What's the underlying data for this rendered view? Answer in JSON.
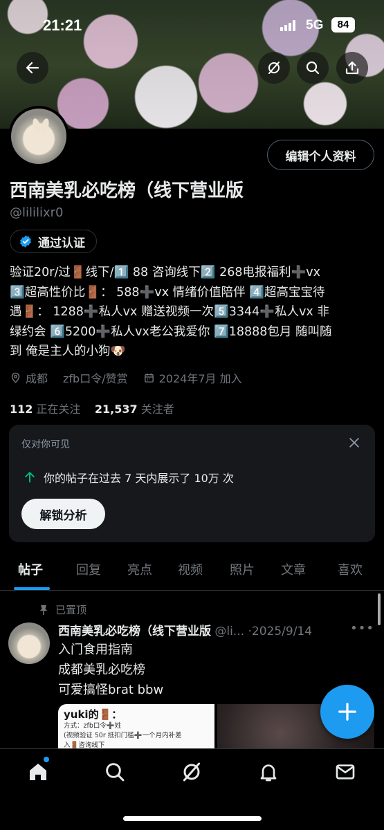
{
  "status_bar": {
    "time": "21:21",
    "network": "5G",
    "battery": "84"
  },
  "profile": {
    "name": "西南美乳必吃榜（线下营业版",
    "handle": "@lililixr0",
    "edit_label": "编辑个人资料",
    "verified_label": "通过认证",
    "bio": "验证20r/过🚪线下/1️⃣ 88 咨询线下2️⃣ 268电报福利➕vx\n3️⃣超高性价比🚪： 588➕vx 情绪价值陪伴 4️⃣超高宝宝待\n遇🚪： 1288➕私人vx 赠送视频一次5️⃣3344➕私人vx 非\n绿约会 6️⃣5200➕私人vx老公我爱你 7️⃣18888包月 随叫随\n到 俺是主人的小狗🐶",
    "location": "成都",
    "website": "zfb口令/赞赏",
    "joined": "2024年7月 加入",
    "following_count": "112",
    "following_label": "正在关注",
    "followers_count": "21,537",
    "followers_label": "关注者"
  },
  "insight_card": {
    "visibility": "仅对你可见",
    "stat_text": "你的帖子在过去 7 天内展示了 10万 次",
    "button_label": "解锁分析"
  },
  "tabs": [
    "帖子",
    "回复",
    "亮点",
    "视频",
    "照片",
    "文章",
    "喜欢"
  ],
  "post": {
    "pinned_label": "已置顶",
    "name": "西南美乳必吃榜（线下营业版",
    "handle": "@li...",
    "date": "·2025/9/14",
    "lines": [
      "入门食用指南",
      "成都美乳必吃榜",
      "可爱搞怪brat  bbw"
    ],
    "media_title": "yuki的🚪：",
    "media_line1": "方式：zfb口令➕姓",
    "media_line2": "(视频验证 50r 抵扣门槛➕一个月内补差",
    "media_line3": "入🚪咨询线下"
  },
  "colors": {
    "accent": "#1d9bf0",
    "background": "#000000",
    "muted": "#71767b"
  },
  "icons": [
    "back-icon",
    "hide-icon",
    "search-icon",
    "share-icon",
    "verified-icon",
    "location-icon",
    "link-icon",
    "calendar-icon",
    "close-icon",
    "trend-up-icon",
    "pin-icon",
    "compose-icon",
    "home-icon",
    "grok-icon",
    "bell-icon",
    "mail-icon"
  ]
}
